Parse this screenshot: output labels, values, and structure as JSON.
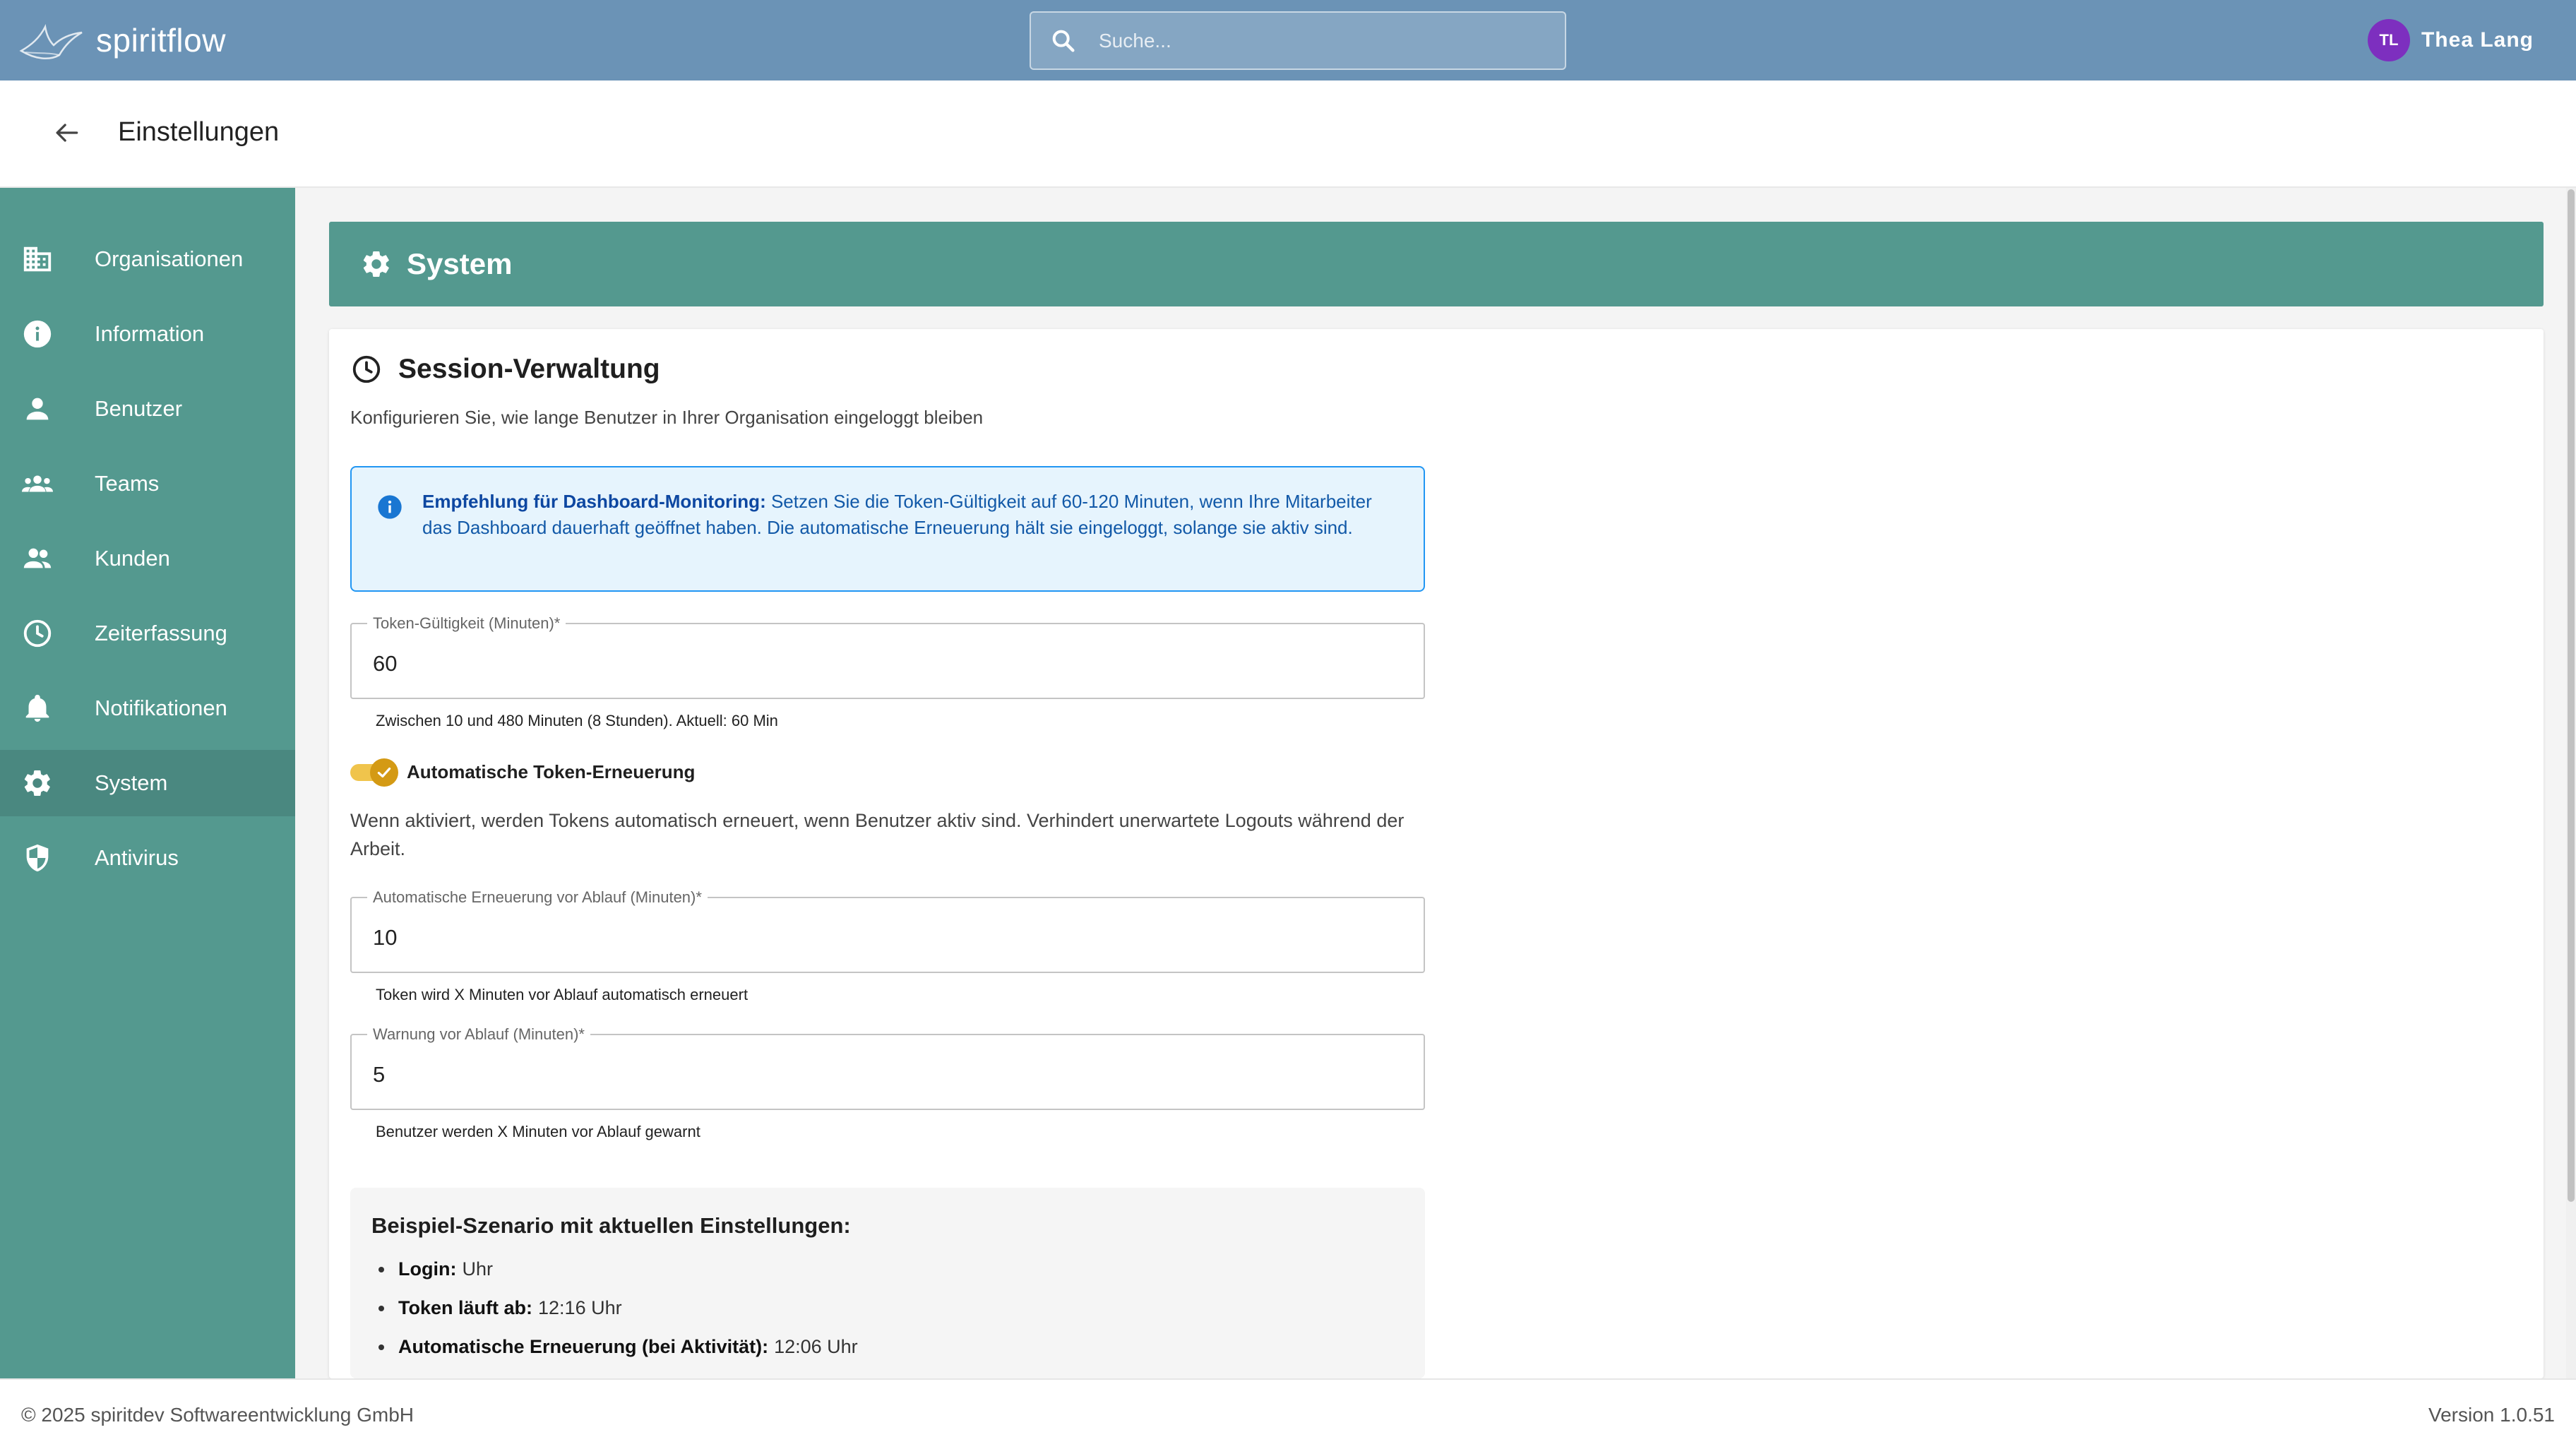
{
  "app": {
    "name": "spiritflow"
  },
  "search": {
    "placeholder": "Suche..."
  },
  "user": {
    "initials": "TL",
    "name": "Thea Lang",
    "avatar_color": "#7d2fbf"
  },
  "page": {
    "title": "Einstellungen"
  },
  "sidebar": {
    "items": [
      {
        "label": "Organisationen",
        "icon": "building-icon"
      },
      {
        "label": "Information",
        "icon": "info-icon"
      },
      {
        "label": "Benutzer",
        "icon": "person-icon"
      },
      {
        "label": "Teams",
        "icon": "groups-icon"
      },
      {
        "label": "Kunden",
        "icon": "people-icon"
      },
      {
        "label": "Zeiterfassung",
        "icon": "clock-icon"
      },
      {
        "label": "Notifikationen",
        "icon": "bell-icon"
      },
      {
        "label": "System",
        "icon": "gear-icon",
        "active": true
      },
      {
        "label": "Antivirus",
        "icon": "shield-icon"
      }
    ]
  },
  "section": {
    "title": "System"
  },
  "session": {
    "title": "Session-Verwaltung",
    "description": "Konfigurieren Sie, wie lange Benutzer in Ihrer Organisation eingeloggt bleiben",
    "info_bold": "Empfehlung für Dashboard-Monitoring:",
    "info_text": " Setzen Sie die Token-Gültigkeit auf 60-120 Minuten, wenn Ihre Mitarbeiter das Dashboard dauerhaft geöffnet haben. Die automatische Erneuerung hält sie eingeloggt, solange sie aktiv sind.",
    "token_field": {
      "label": "Token-Gültigkeit (Minuten)*",
      "value": "60",
      "helper": "Zwischen 10 und 480 Minuten (8 Stunden). Aktuell: 60 Min"
    },
    "auto_renew": {
      "label": "Automatische Token-Erneuerung",
      "enabled": true,
      "description": "Wenn aktiviert, werden Tokens automatisch erneuert, wenn Benutzer aktiv sind. Verhindert unerwartete Logouts während der Arbeit."
    },
    "renew_field": {
      "label": "Automatische Erneuerung vor Ablauf (Minuten)*",
      "value": "10",
      "helper": "Token wird X Minuten vor Ablauf automatisch erneuert"
    },
    "warn_field": {
      "label": "Warnung vor Ablauf (Minuten)*",
      "value": "5",
      "helper": "Benutzer werden X Minuten vor Ablauf gewarnt"
    },
    "example": {
      "title": "Beispiel-Szenario mit aktuellen Einstellungen:",
      "rows": [
        {
          "label": "Login:",
          "value": "Uhr"
        },
        {
          "label": "Token läuft ab:",
          "value": "12:16 Uhr"
        },
        {
          "label": "Automatische Erneuerung (bei Aktivität):",
          "value": "12:06 Uhr"
        }
      ]
    }
  },
  "footer": {
    "copyright": "© 2025 spiritdev Softwareentwicklung GmbH",
    "version": "Version 1.0.51"
  },
  "colors": {
    "topbar": "#6b93b6",
    "sidebar": "#54998f",
    "accent": "#54998f",
    "toggle": "#d49a14",
    "info_border": "#2196f3"
  }
}
